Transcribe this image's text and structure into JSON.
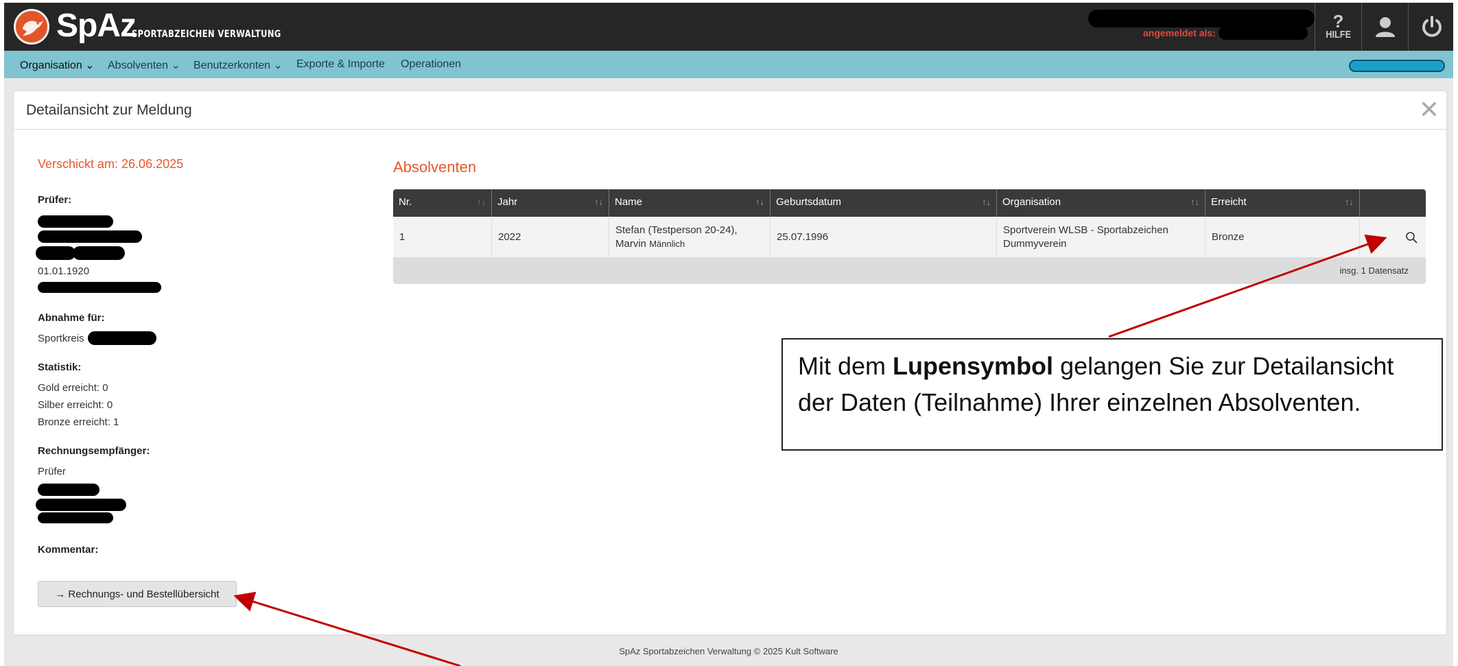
{
  "app": {
    "logo_text": "SpAz",
    "logo_subtitle": "SPORTABZEICHEN VERWALTUNG",
    "logged_in_label": "angemeldet als:",
    "help_label": "HILFE",
    "help_symbol": "?"
  },
  "nav": {
    "items": [
      {
        "label": "Organisation",
        "has_dropdown": true
      },
      {
        "label": "Absolventen",
        "has_dropdown": true
      },
      {
        "label": "Benutzerkonten",
        "has_dropdown": true
      },
      {
        "label": "Exporte & Importe",
        "has_dropdown": false
      },
      {
        "label": "Operationen",
        "has_dropdown": false
      }
    ]
  },
  "panel": {
    "title": "Detailansicht zur Meldung",
    "sent_label": "Verschickt am: 26.06.2025",
    "pruefer_label": "Prüfer:",
    "pruefer_date": "01.01.1920",
    "abnahme_label": "Abnahme für:",
    "abnahme_value": "Sportkreis",
    "statistik_label": "Statistik:",
    "gold": "Gold erreicht: 0",
    "silber": "Silber erreicht: 0",
    "bronze": "Bronze erreicht: 1",
    "rechnung_label": "Rechnungsempfänger:",
    "rechnung_value": "Prüfer",
    "kommentar_label": "Kommentar:",
    "back_button": "Rechnungs- und Bestellübersicht",
    "back_arrow": "→"
  },
  "table": {
    "title": "Absolventen",
    "columns": [
      "Nr.",
      "Jahr",
      "Name",
      "Geburtsdatum",
      "Organisation",
      "Erreicht",
      ""
    ],
    "rows": [
      {
        "nr": "1",
        "jahr": "2022",
        "name_line1": "Stefan (Testperson 20-24),",
        "name_line2": "Marvin",
        "gender": "Männlich",
        "geburtsdatum": "25.07.1996",
        "org_line1": "Sportverein WLSB - Sportabzeichen",
        "org_line2": "Dummyverein",
        "erreicht": "Bronze"
      }
    ],
    "footer": "insg. 1 Datensatz",
    "sort_icon": "↑↓"
  },
  "callout": {
    "pre": "Mit dem ",
    "bold": "Lupensymbol",
    "post": " gelangen Sie zur Detailansicht der Daten (Teilnahme) Ihrer einzelnen Absolventen."
  },
  "footer": "SpAz Sportabzeichen Verwaltung © 2025 Kult Software",
  "colors": {
    "accent_orange": "#e8572a",
    "nav_bg": "#7fc4d0",
    "topbar_bg": "#262626",
    "annotation_red": "#c00000"
  }
}
